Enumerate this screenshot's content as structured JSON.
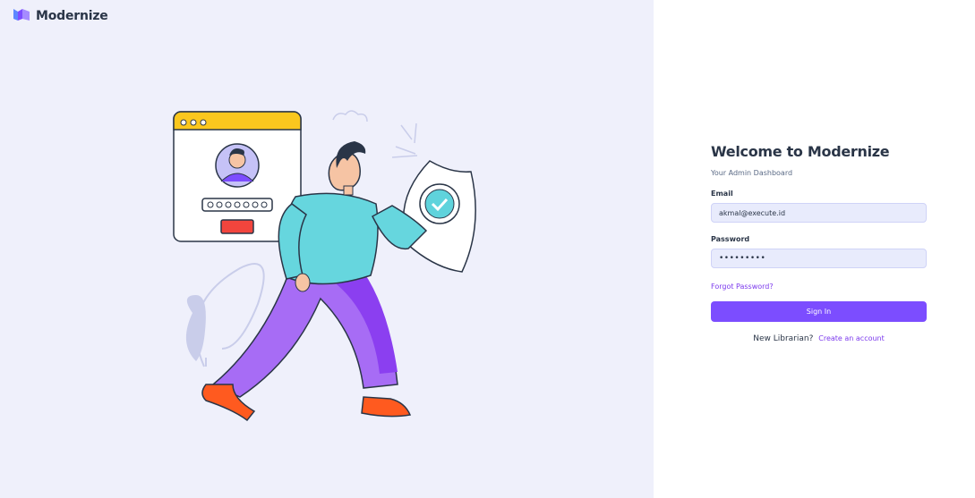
{
  "brand": {
    "name": "Modernize",
    "logo_icon": "modernize-logo-icon"
  },
  "illustration": {
    "icon": "secure-login-illustration"
  },
  "login": {
    "title": "Welcome to Modernize",
    "subtitle": "Your Admin Dashboard",
    "email_label": "Email",
    "email_value": "akmal@execute.id",
    "password_label": "Password",
    "password_value": "•••••••••",
    "forgot_link": "Forgot Password?",
    "signin_button": "Sign In",
    "new_user_text": "New Librarian?",
    "create_account_link": "Create an account"
  },
  "colors": {
    "left_background": "#eff0fb",
    "accent": "#7c4dff",
    "input_background": "#e8ebfc",
    "text_primary": "#2a3547"
  }
}
